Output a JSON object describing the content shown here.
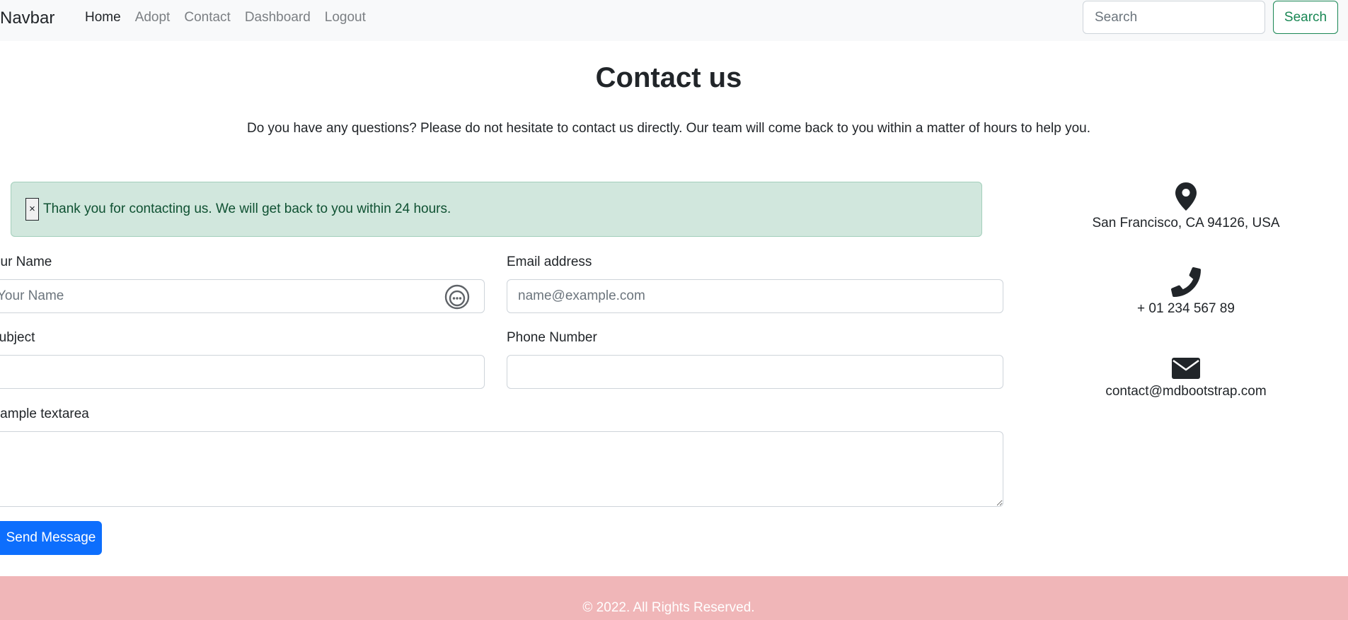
{
  "navbar": {
    "brand": "Navbar",
    "links": [
      "Home",
      "Adopt",
      "Contact",
      "Dashboard",
      "Logout"
    ],
    "search_placeholder": "Search",
    "search_button": "Search"
  },
  "header": {
    "title": "Contact us",
    "subtitle": "Do you have any questions? Please do not hesitate to contact us directly. Our team will come back to you within a matter of hours to help you."
  },
  "alert": {
    "close_label": "×",
    "message": "Thank you for contacting us. We will get back to you within 24 hours."
  },
  "form": {
    "name_label": "Your Name",
    "name_placeholder": "Your Name",
    "email_label": "Email address",
    "email_placeholder": "name@example.com",
    "subject_label": "Subject",
    "phone_label": "Phone Number",
    "textarea_label": "Example textarea",
    "submit_label": "Send Message"
  },
  "contact_info": {
    "address": "San Francisco, CA 94126, USA",
    "phone": "+ 01 234 567 89",
    "email": "contact@mdbootstrap.com",
    "icons": [
      "map-marker-icon",
      "phone-icon",
      "envelope-icon"
    ]
  },
  "footer": {
    "text": "© 2022. All Rights Reserved."
  },
  "colors": {
    "success_bg": "#d1e7dd",
    "success_text": "#0f5132",
    "primary": "#0d6efd",
    "search_green": "#198754",
    "footer_bg": "#f0b6b8"
  }
}
